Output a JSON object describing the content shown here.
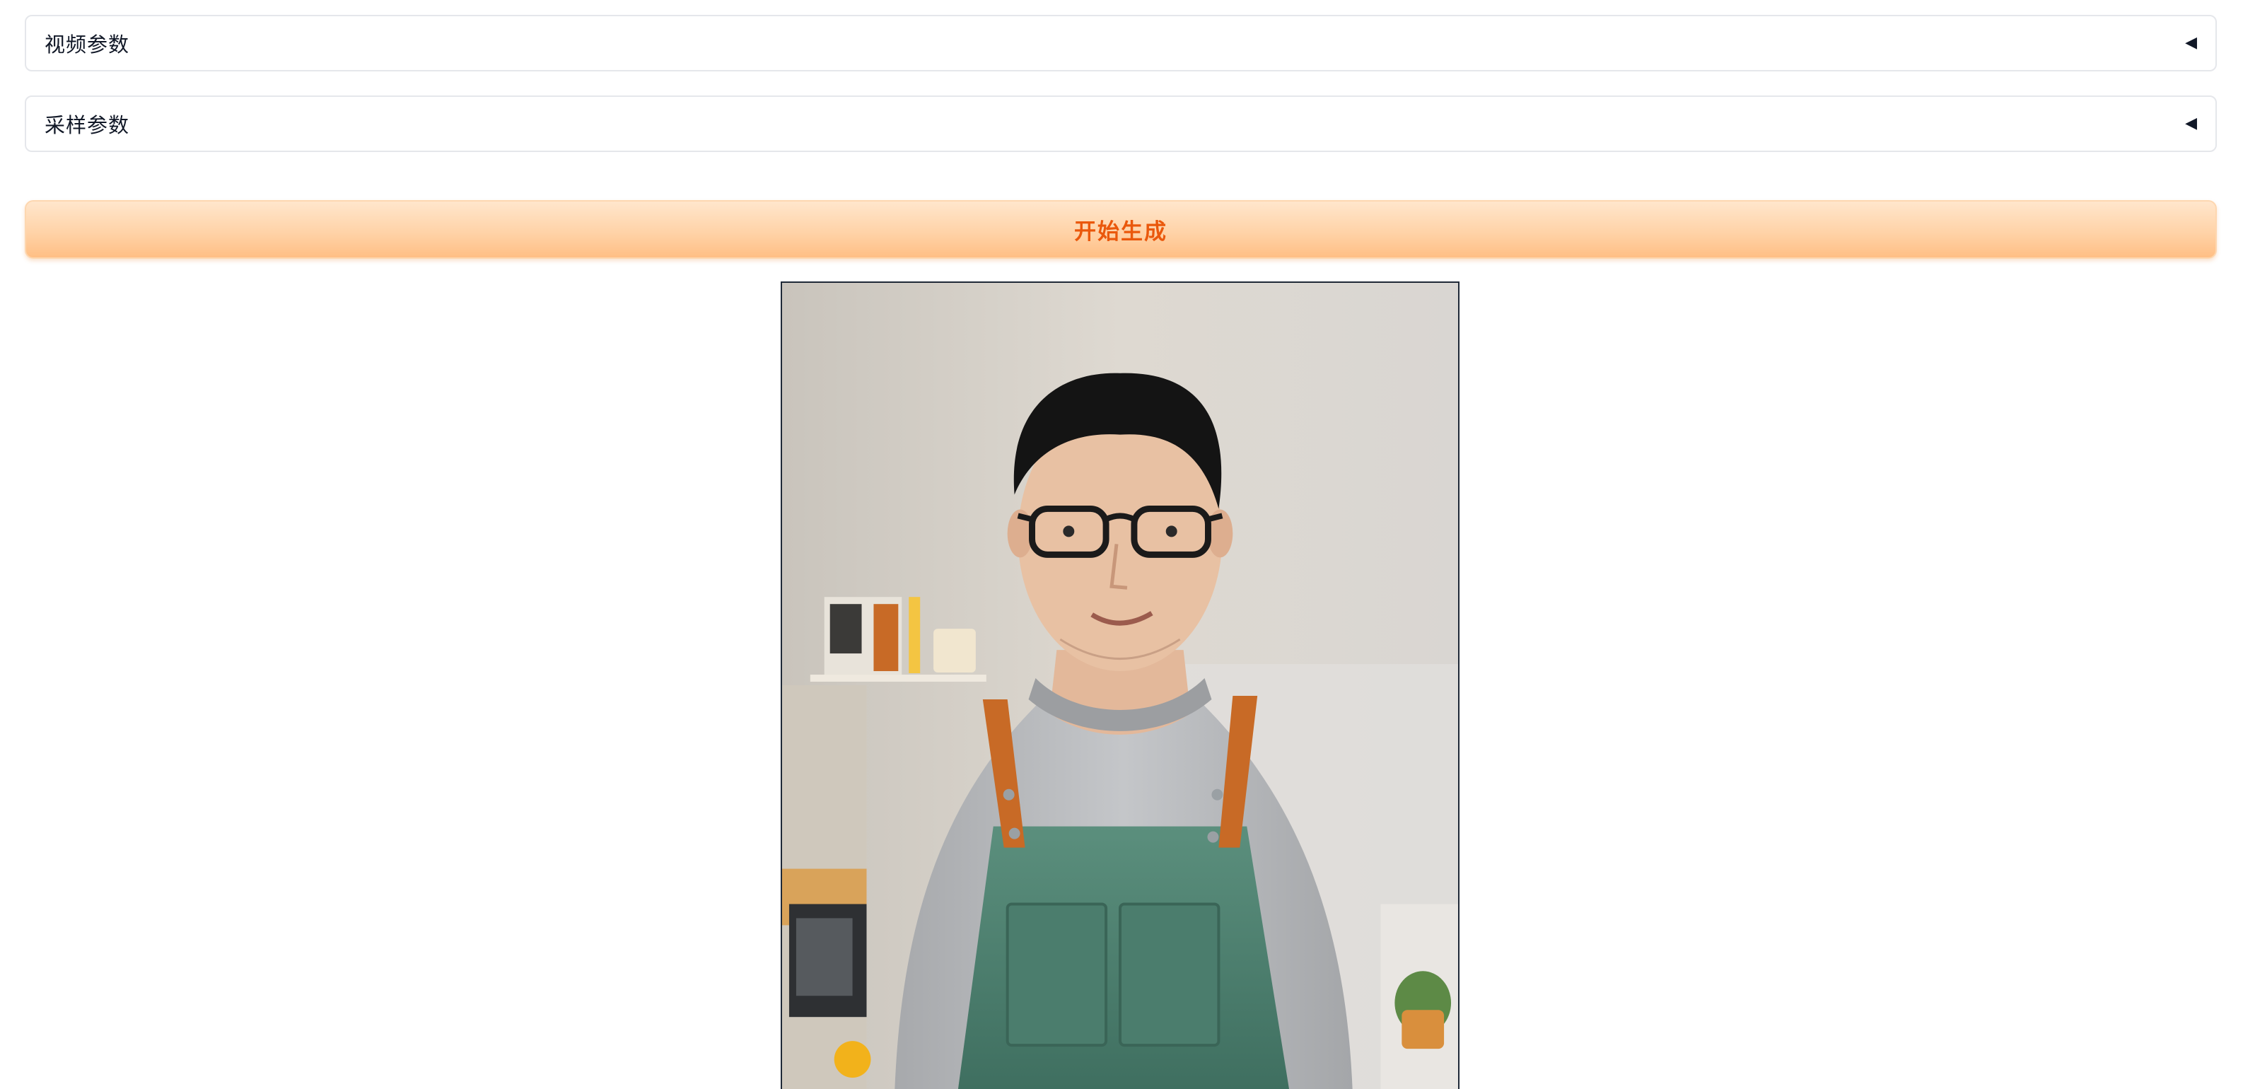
{
  "panels": {
    "video_params": {
      "label": "视频参数",
      "collapsed_icon": "◀"
    },
    "sampling_params": {
      "label": "采样参数",
      "collapsed_icon": "◀"
    }
  },
  "actions": {
    "generate_label": "开始生成"
  },
  "preview": {
    "subject": "portrait-photo",
    "colors": {
      "wall": "#ddd8d0",
      "apron": "#4f8674",
      "strap": "#c86a26",
      "shirt": "#b8babd",
      "accent": "#ea580c"
    }
  }
}
